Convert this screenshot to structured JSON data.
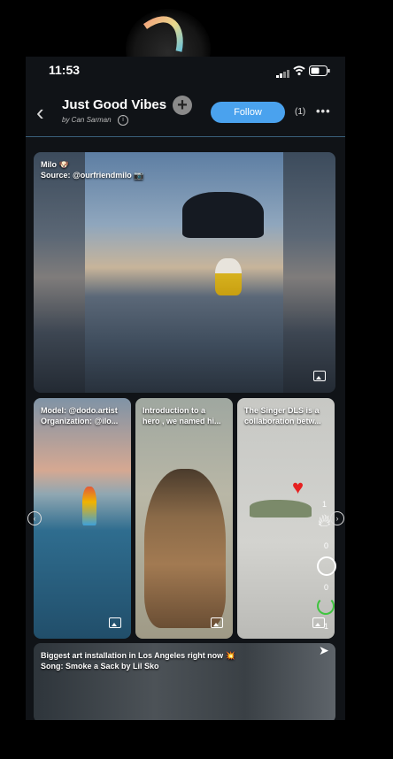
{
  "status_bar": {
    "time": "11:53"
  },
  "header": {
    "title": "Just Good Vibes",
    "byline": "by Can Sarman",
    "follow_label": "Follow",
    "follower_count": "(1)"
  },
  "feed": {
    "featured": {
      "caption": "Milo 🐶\nSource: @ourfriendmilo 📷"
    },
    "cards": [
      {
        "caption": "Model: @dodo.artist\nOrganization: @ilo..."
      },
      {
        "caption": "Introduction to a\nhero , we named hi..."
      },
      {
        "caption": "The Singer DLS is a\ncollaboration betw..."
      }
    ],
    "wide": {
      "caption": "Biggest art installation in Los Angeles right now 💥\nSong: Smoke a Sack by Lil Sko"
    }
  },
  "actions": {
    "like_count": "1",
    "fire_count": "0",
    "comment_count": "0",
    "repost_count": "1"
  },
  "colors": {
    "accent": "#4aa2ee",
    "like": "#e62020",
    "repost": "#3fc43f"
  },
  "icons": [
    "back-icon",
    "add-icon",
    "info-icon",
    "more-icon",
    "image-icon",
    "heart-icon",
    "fire-icon",
    "comment-icon",
    "repost-icon",
    "send-icon",
    "chevron-left-icon",
    "chevron-right-icon"
  ]
}
